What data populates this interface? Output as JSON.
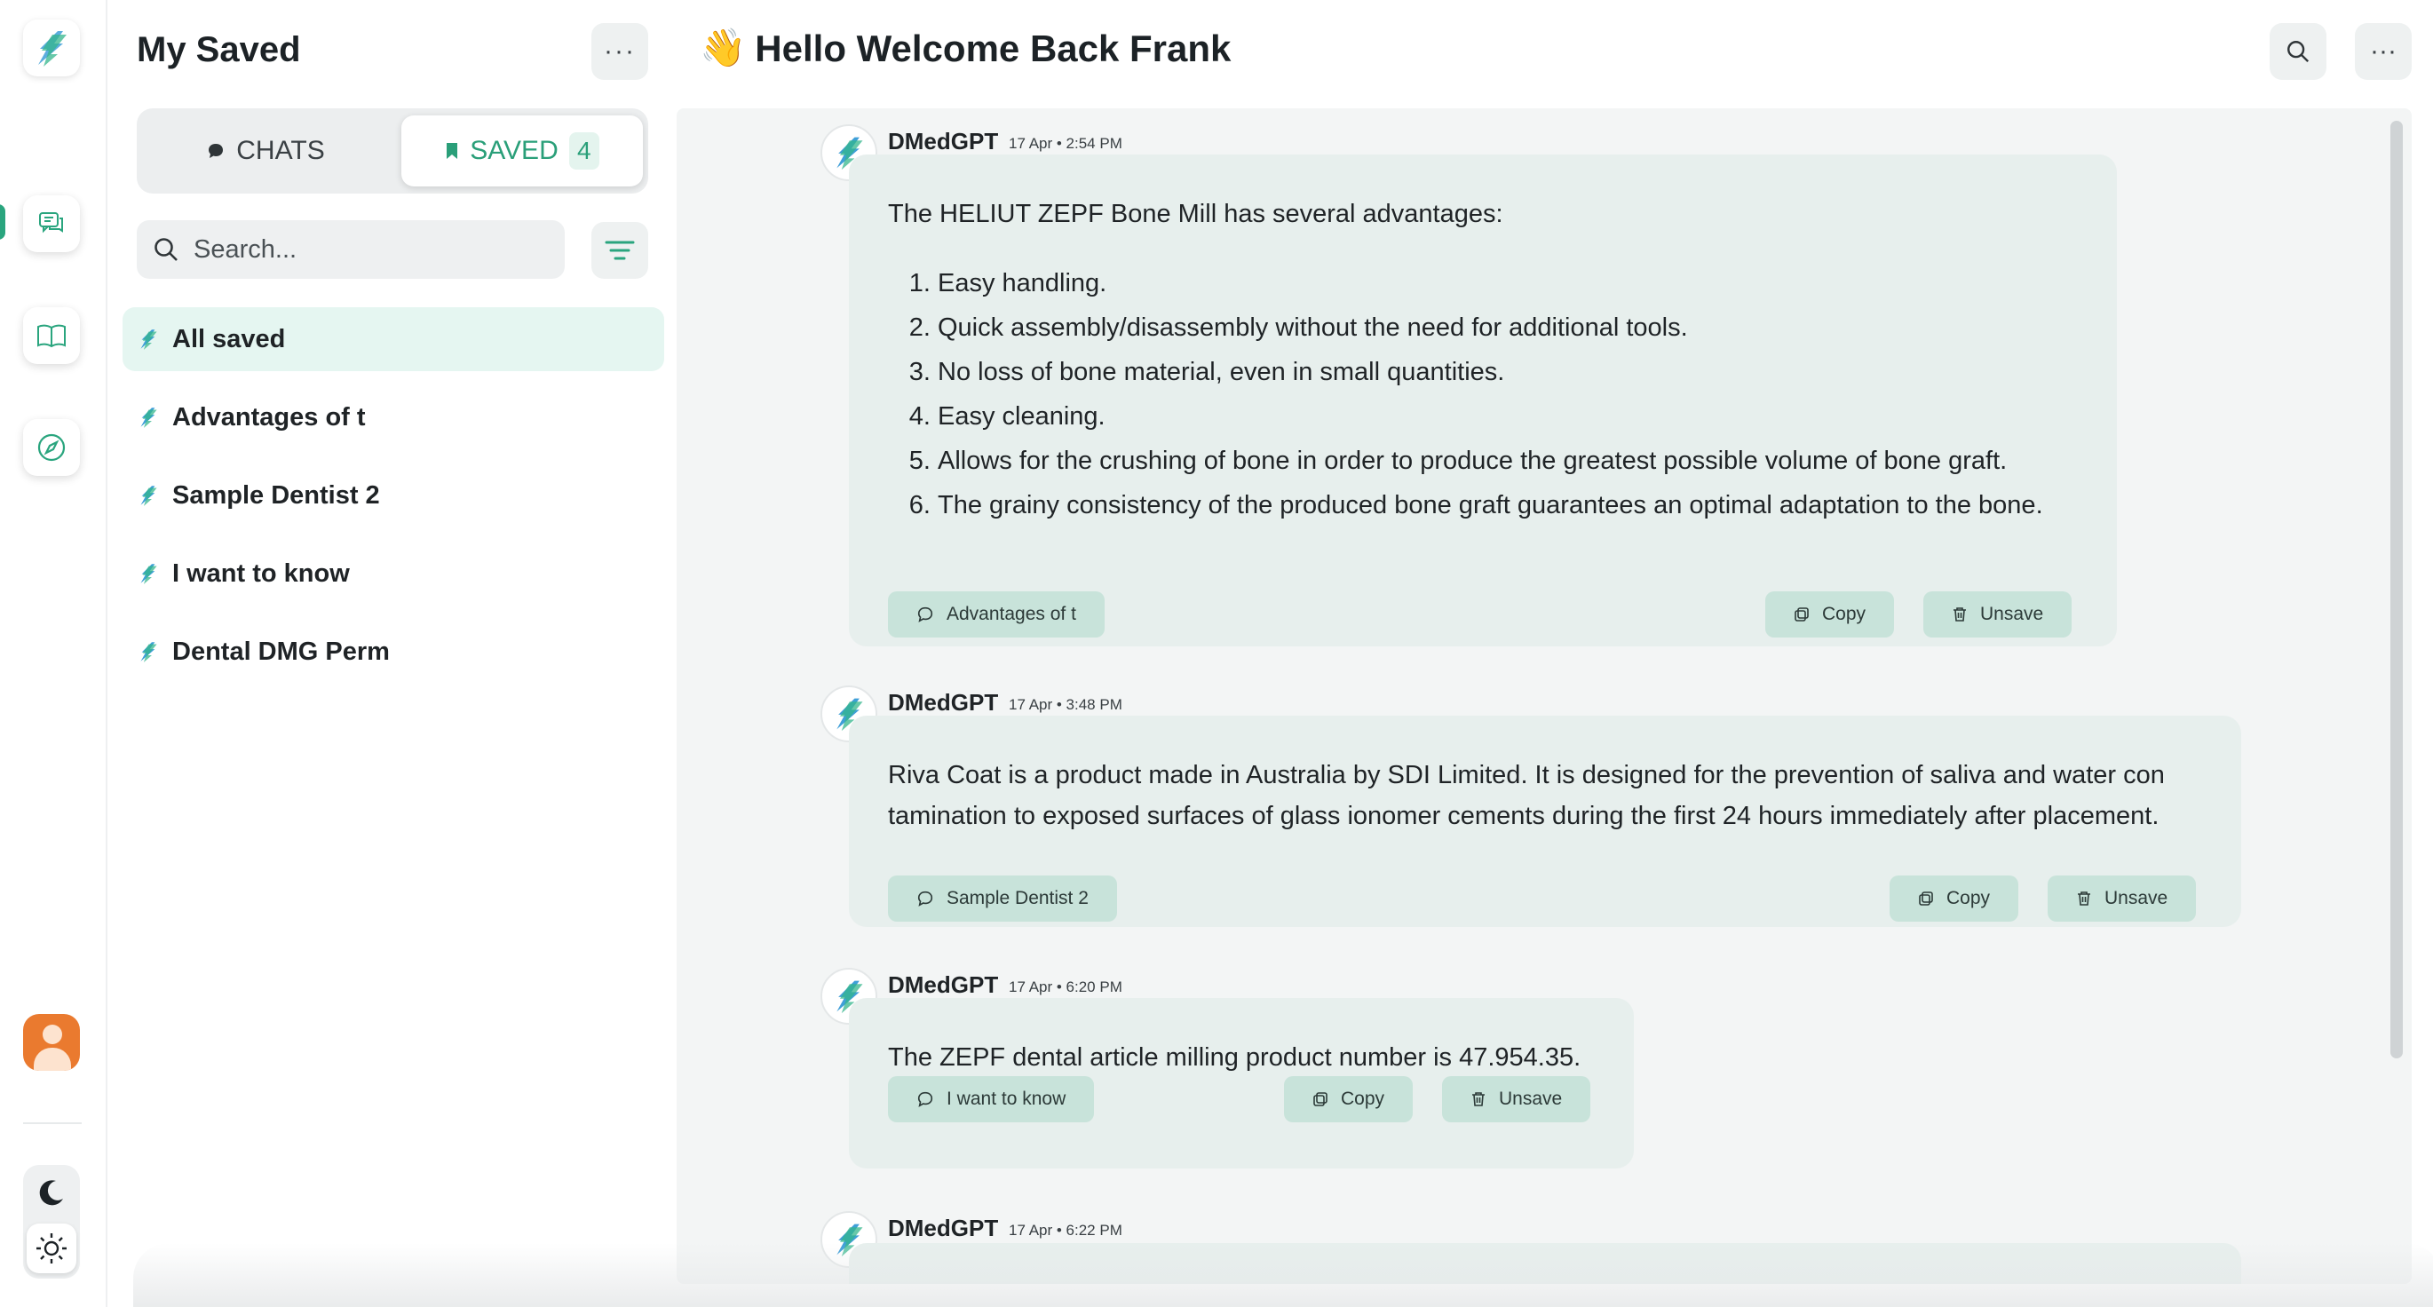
{
  "sidebar_rail": {
    "logo_icon": "dmedgpt-logo-icon",
    "nav_items": [
      {
        "name": "chats",
        "icon": "chat-bubbles-icon"
      },
      {
        "name": "library",
        "icon": "open-book-icon"
      },
      {
        "name": "explore",
        "icon": "compass-icon"
      }
    ],
    "avatar_icon": "user-avatar-icon",
    "theme": {
      "dark_icon": "moon-icon",
      "light_icon": "sun-icon",
      "active": "light"
    }
  },
  "saved_panel": {
    "title": "My Saved",
    "more_icon": "ellipsis-icon",
    "more_label": "···",
    "tabs": {
      "chats_label": "CHATS",
      "saved_label": "SAVED",
      "saved_count": "4",
      "active": "saved"
    },
    "search": {
      "placeholder": "Search...",
      "value": ""
    },
    "filter_icon": "filter-lines-icon",
    "items": [
      {
        "label": "All saved",
        "active": true
      },
      {
        "label": "Advantages of t",
        "active": false
      },
      {
        "label": "Sample Dentist 2",
        "active": false
      },
      {
        "label": "I want to know",
        "active": false
      },
      {
        "label": "Dental DMG Perm",
        "active": false
      }
    ]
  },
  "header": {
    "emoji": "👋",
    "title": "Hello Welcome Back Frank",
    "search_icon": "search-icon",
    "more_icon": "ellipsis-icon",
    "more_label": "···"
  },
  "messages": [
    {
      "author": "DMedGPT",
      "time": "17 Apr • 2:54 PM",
      "intro": "The HELIUT ZEPF Bone Mill has several advantages:",
      "list": [
        "Easy handling.",
        "Quick assembly/disassembly without the need for additional tools.",
        "No loss of bone material, even in small quantities.",
        "Easy cleaning.",
        "Allows for the crushing of bone in order to produce the greatest possible volume of bone graft.",
        "The grainy consistency of the produced bone graft guarantees an optimal adaptation to the bone."
      ],
      "source_chat": "Advantages of t",
      "copy_label": "Copy",
      "unsave_label": "Unsave"
    },
    {
      "author": "DMedGPT",
      "time": "17 Apr • 3:48 PM",
      "text_line1": "Riva Coat is a product made in Australia by SDI Limited. It is designed for the prevention of saliva and water con",
      "text_line2": "tamination to exposed surfaces of glass ionomer cements during the first 24 hours immediately after placement.",
      "source_chat": "Sample Dentist 2",
      "copy_label": "Copy",
      "unsave_label": "Unsave"
    },
    {
      "author": "DMedGPT",
      "time": "17 Apr • 6:20 PM",
      "text": "The ZEPF dental article milling product number is 47.954.35.",
      "source_chat": "I want to know",
      "copy_label": "Copy",
      "unsave_label": "Unsave"
    },
    {
      "author": "DMedGPT",
      "time": "17 Apr • 6:22 PM"
    }
  ],
  "colors": {
    "accent": "#2aa57e",
    "active_item_bg": "#e5f6f1",
    "bubble_bg": "#e7efed",
    "chip_bg": "#c8e3da",
    "avatar_orange": "#ea7a2f"
  }
}
